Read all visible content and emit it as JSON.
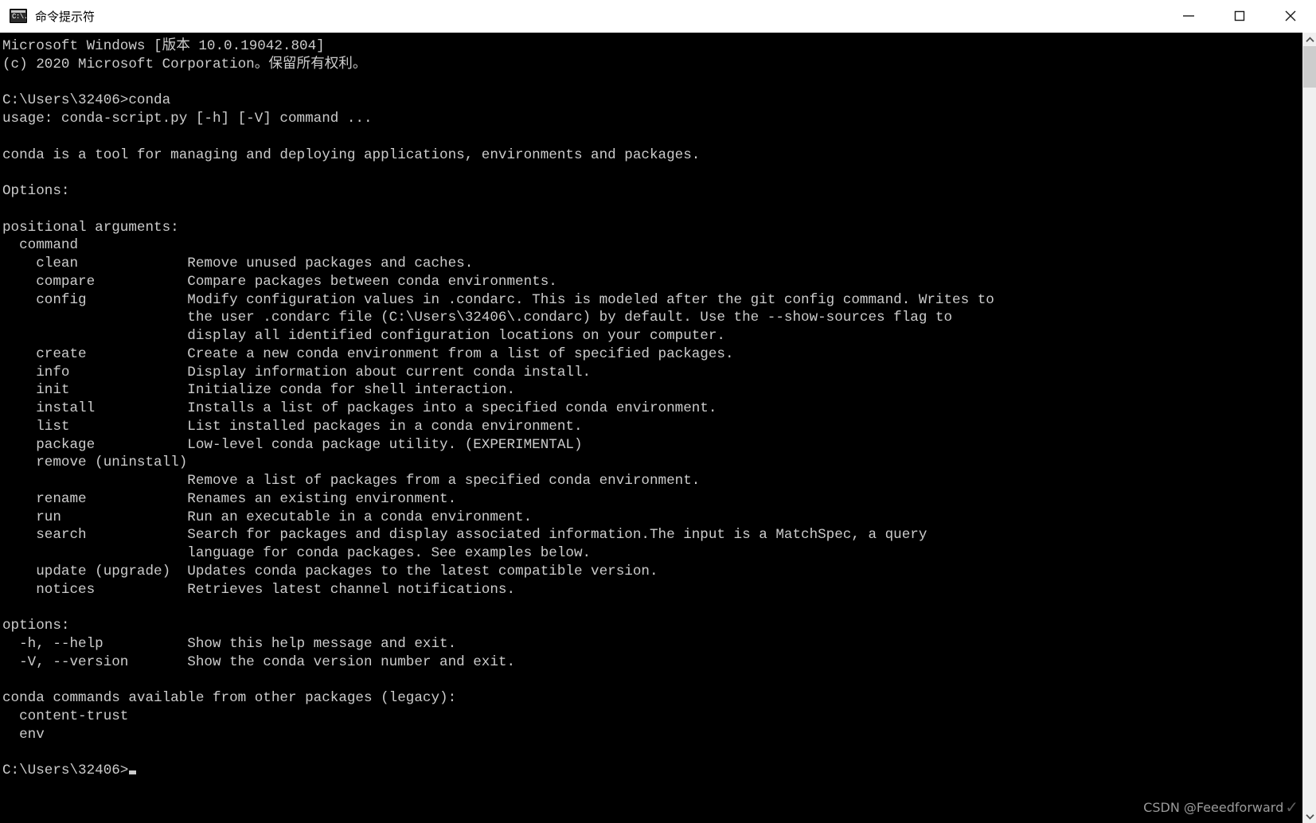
{
  "window": {
    "title": "命令提示符",
    "icon": "cmd-icon",
    "icon_glyph": "C:\\.",
    "controls": {
      "minimize": "—",
      "maximize": "☐",
      "close": "✕"
    }
  },
  "scrollbar": {
    "up_arrow": "▲",
    "down_arrow": "▼"
  },
  "watermark": {
    "text": "CSDN @Feeedforward",
    "check": "✓"
  },
  "console": {
    "background": "#000000",
    "foreground": "#cccccc",
    "lines": [
      "Microsoft Windows [版本 10.0.19042.804]",
      "(c) 2020 Microsoft Corporation。保留所有权利。",
      "",
      "C:\\Users\\32406>conda",
      "usage: conda-script.py [-h] [-V] command ...",
      "",
      "conda is a tool for managing and deploying applications, environments and packages.",
      "",
      "Options:",
      "",
      "positional arguments:",
      "  command",
      "    clean             Remove unused packages and caches.",
      "    compare           Compare packages between conda environments.",
      "    config            Modify configuration values in .condarc. This is modeled after the git config command. Writes to",
      "                      the user .condarc file (C:\\Users\\32406\\.condarc) by default. Use the --show-sources flag to",
      "                      display all identified configuration locations on your computer.",
      "    create            Create a new conda environment from a list of specified packages.",
      "    info              Display information about current conda install.",
      "    init              Initialize conda for shell interaction.",
      "    install           Installs a list of packages into a specified conda environment.",
      "    list              List installed packages in a conda environment.",
      "    package           Low-level conda package utility. (EXPERIMENTAL)",
      "    remove (uninstall)",
      "                      Remove a list of packages from a specified conda environment.",
      "    rename            Renames an existing environment.",
      "    run               Run an executable in a conda environment.",
      "    search            Search for packages and display associated information.The input is a MatchSpec, a query",
      "                      language for conda packages. See examples below.",
      "    update (upgrade)  Updates conda packages to the latest compatible version.",
      "    notices           Retrieves latest channel notifications.",
      "",
      "options:",
      "  -h, --help          Show this help message and exit.",
      "  -V, --version       Show the conda version number and exit.",
      "",
      "conda commands available from other packages (legacy):",
      "  content-trust",
      "  env",
      ""
    ],
    "prompt": "C:\\Users\\32406>"
  }
}
